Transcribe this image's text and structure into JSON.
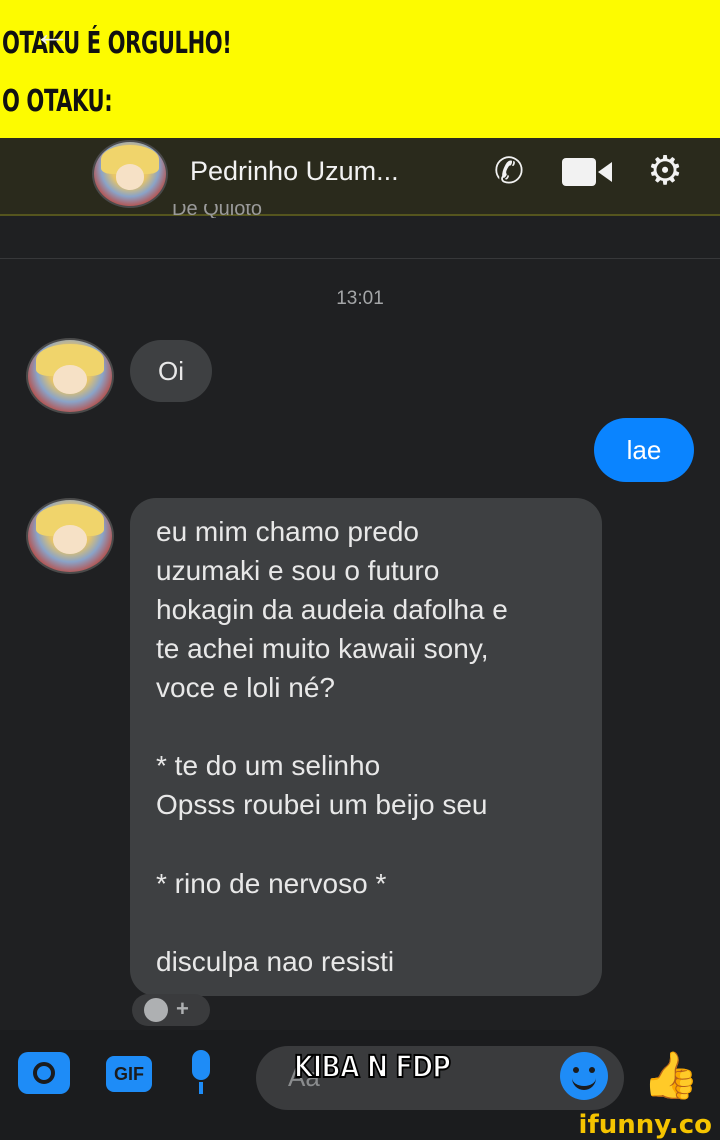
{
  "caption": {
    "line1": "OTAKU É ORGULHO!",
    "line2": "O OTAKU:"
  },
  "header": {
    "back_glyph": "←",
    "contact_name": "Pedrinho Uzum...",
    "subtitle": "De Quioto",
    "icons": [
      "back-arrow-icon",
      "phone-icon",
      "video-camera-icon",
      "gear-icon"
    ]
  },
  "conversation": {
    "timestamp": "13:01",
    "messages": [
      {
        "from": "contact",
        "text": "Oi"
      },
      {
        "from": "me",
        "text": "lae"
      },
      {
        "from": "contact",
        "lines": [
          "eu mim chamo predo",
          "uzumaki e sou o futuro",
          "hokagin da audeia dafolha e",
          "te achei muito kawaii sony,",
          "voce e loli né?",
          "",
          "* te do um selinho",
          "Opsss roubei um beijo seu",
          "",
          "* rino de nervoso *",
          "",
          "disculpa nao resisti"
        ]
      }
    ]
  },
  "composer": {
    "placeholder": "Aa",
    "gif_label": "GIF",
    "icons": [
      "camera-icon",
      "gif-icon",
      "microphone-icon",
      "emoji-icon",
      "thumbs-up-icon"
    ]
  },
  "overlay_text": "KIBA N FDP",
  "watermark": "ifunny.co",
  "colors": {
    "caption_bg": "#fdfb00",
    "chat_bg": "#1f2022",
    "incoming_bubble": "#3e4042",
    "outgoing_bubble": "#0a84ff",
    "accent": "#1e8cf7"
  }
}
